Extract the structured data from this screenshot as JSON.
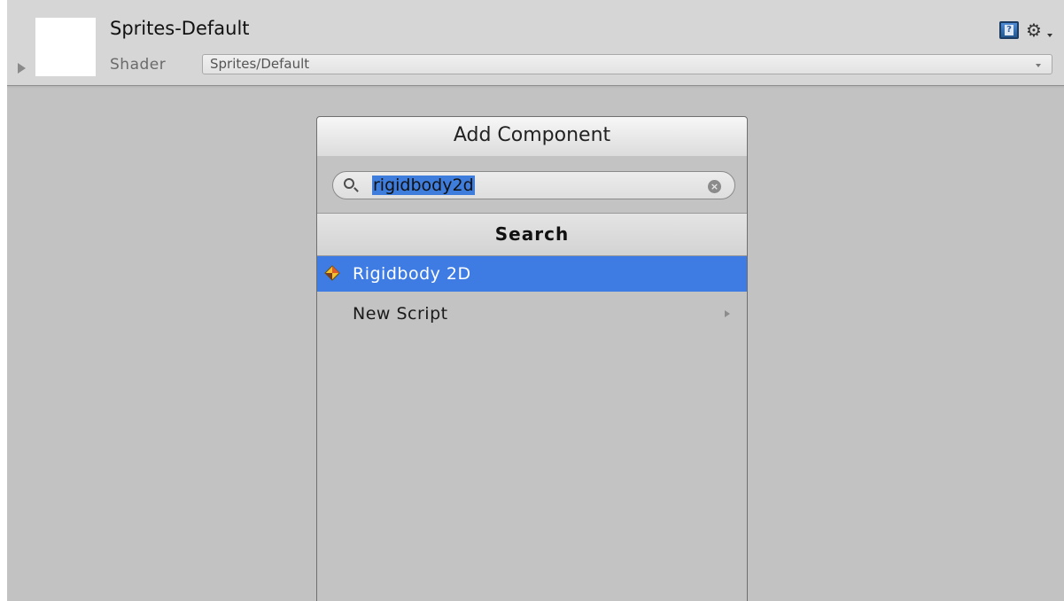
{
  "material": {
    "title": "Sprites-Default",
    "shader_label": "Shader",
    "shader_value": "Sprites/Default"
  },
  "add_component": {
    "button_label": "Add Component",
    "search_value": "rigidbody2d",
    "section_title": "Search",
    "results": [
      {
        "label": "Rigidbody 2D",
        "icon": "rigidbody2d-icon",
        "selected": true
      },
      {
        "label": "New Script",
        "icon": "submenu-arrow-icon",
        "selected": false
      }
    ]
  },
  "colors": {
    "selection": "#3e7ce4",
    "panel_bg": "#c2c2c2",
    "header_bg": "#d6d6d6"
  }
}
